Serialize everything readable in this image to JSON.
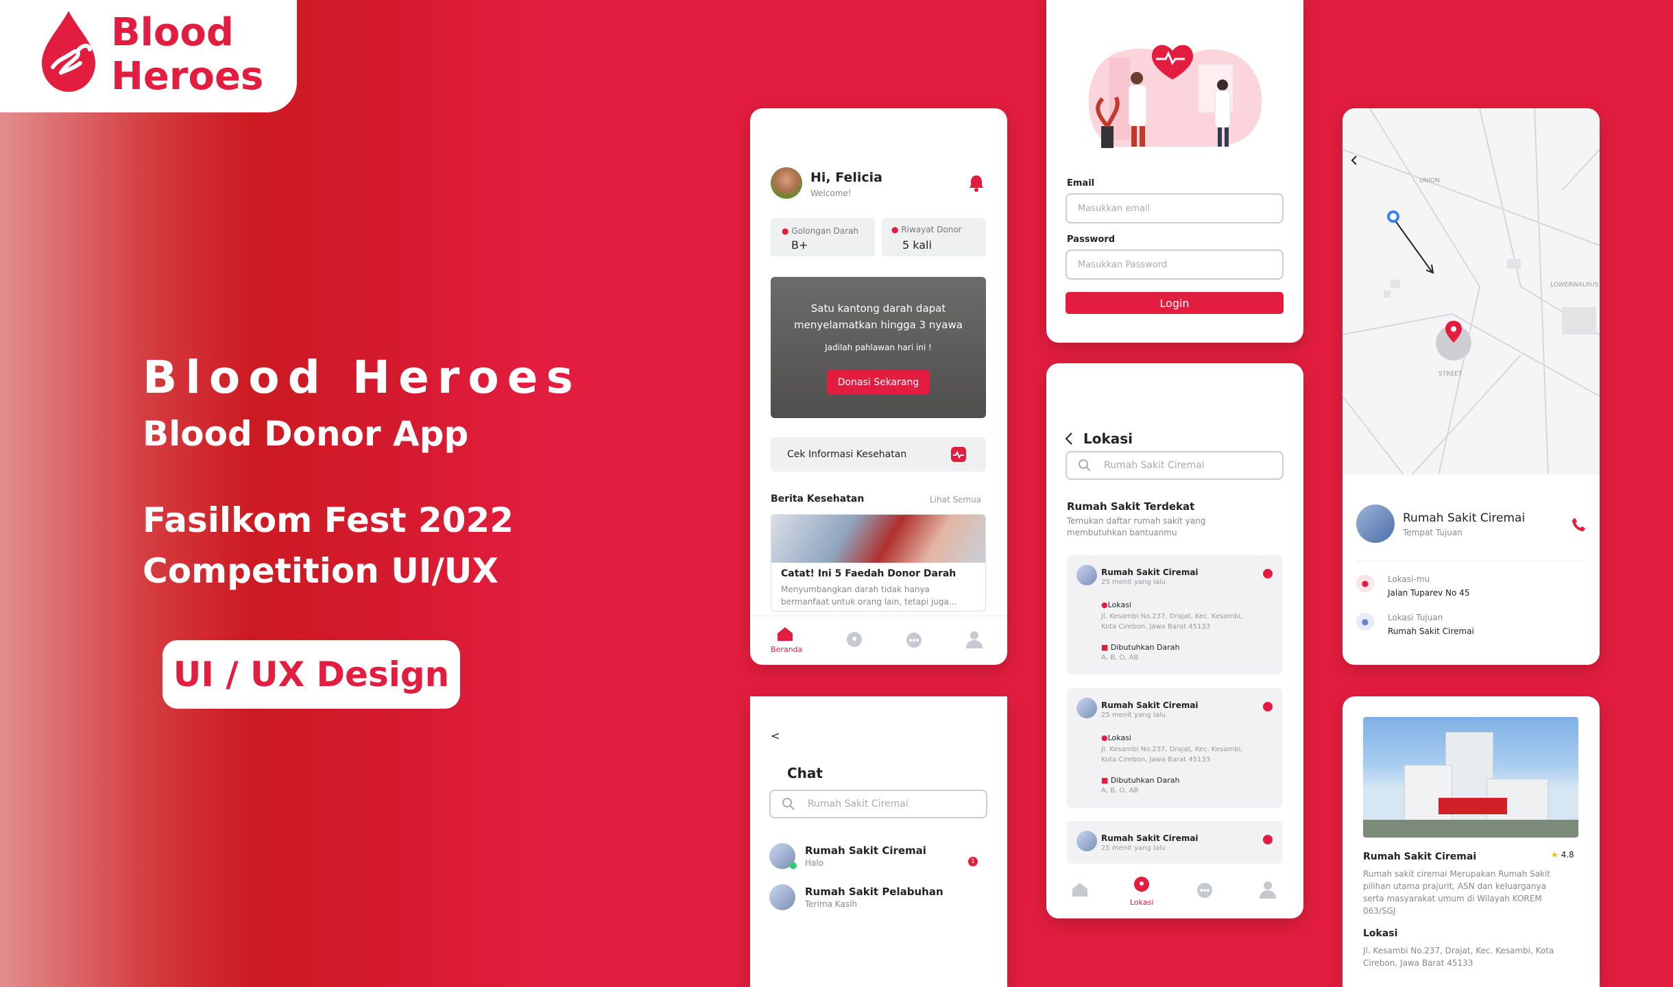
{
  "brand": {
    "logo_line1": "Blood",
    "logo_line2": "Heroes"
  },
  "hero": {
    "title": "Blood Heroes",
    "subtitle": "Blood Donor App",
    "fest_line1": "Fasilkom Fest 2022",
    "fest_line2": "Competition UI/UX",
    "pill": "UI / UX Design"
  },
  "home": {
    "greeting": "Hi, Felicia",
    "welcome": "Welcome!",
    "blood_type_label": "Golongan Darah",
    "blood_type": "B+",
    "history_label": "Riwayat Donor",
    "history": "5 kali",
    "banner_line1": "Satu kantong darah dapat",
    "banner_line2": "menyelamatkan hingga 3 nyawa",
    "banner_tag": "Jadilah pahlawan hari ini !",
    "banner_button": "Donasi Sekarang",
    "health_check": "Cek Informasi Kesehatan",
    "news_title": "Berita Kesehatan",
    "news_all": "Lihat Semua",
    "article_title": "Catat! Ini 5 Faedah Donor Darah",
    "article_line1": "Menyumbangkan darah tidak hanya",
    "article_line2": "bermanfaat untuk orang lain, tetapi juga...",
    "nav_home": "Beranda"
  },
  "login": {
    "email_label": "Email",
    "email_placeholder": "Masukkan email",
    "password_label": "Password",
    "password_placeholder": "Masukkan Password",
    "button": "Login"
  },
  "chat": {
    "back": "<",
    "title": "Chat",
    "search_placeholder": "Rumah Sakit Ciremai",
    "items": [
      {
        "name": "Rumah Sakit Ciremai",
        "msg": "Halo",
        "badge": "1"
      },
      {
        "name": "Rumah Sakit Pelabuhan",
        "msg": "Terima Kasih"
      }
    ]
  },
  "lokasi": {
    "title": "Lokasi",
    "search_placeholder": "Rumah Sakit Ciremai",
    "section_title": "Rumah Sakit Terdekat",
    "section_line1": "Temukan daftar rumah sakit yang",
    "section_line2": "membutuhkan bantuanmu",
    "cards": [
      {
        "name": "Rumah Sakit Ciremai",
        "time": "25 menit yang lalu",
        "loc_label": "Lokasi",
        "addr1": "Jl. Kesambi No.237, Drajat, Kec. Kesambi,",
        "addr2": "Kota Cirebon, Jawa Barat 45133",
        "need_label": "Dibutuhkan Darah",
        "need": "A, B, O, AB"
      },
      {
        "name": "Rumah Sakit Ciremai",
        "time": "25 menit yang lalu",
        "loc_label": "Lokasi",
        "addr1": "Jl. Kesambi No.237, Drajat, Kec. Kesambi,",
        "addr2": "Kota Cirebon, Jawa Barat 45133",
        "need_label": "Dibutuhkan Darah",
        "need": "A, B, O, AB"
      },
      {
        "name": "Rumah Sakit Ciremai",
        "time": "25 menit yang lalu"
      }
    ],
    "nav_active": "Lokasi"
  },
  "map": {
    "label_union": "UNION",
    "label_street": "STREET",
    "label_lower": "LOWERWALRUS",
    "hospital": "Rumah Sakit Ciremai",
    "dest": "Tempat Tujuan",
    "my_loc_label": "Lokasi-mu",
    "my_loc": "Jalan Tuparev No 45",
    "target_label": "Lokasi Tujuan",
    "target": "Rumah Sakit Ciremai"
  },
  "detail": {
    "name": "Rumah Sakit Ciremai",
    "rating": "4.8",
    "desc1": "Rumah sakit ciremai Merupakan Rumah Sakit",
    "desc2": "pilihan utama prajurit, ASN dan keluarganya",
    "desc3": "serta masyarakat umum di Wilayah KOREM",
    "desc4": "063/SGJ",
    "loc_title": "Lokasi",
    "addr1": "Jl. Kesambi No.237, Drajat, Kec. Kesambi, Kota",
    "addr2": "Cirebon, Jawa Barat 45133"
  },
  "colors": {
    "primary": "#e31d3f",
    "bg": "#e31d3f"
  }
}
